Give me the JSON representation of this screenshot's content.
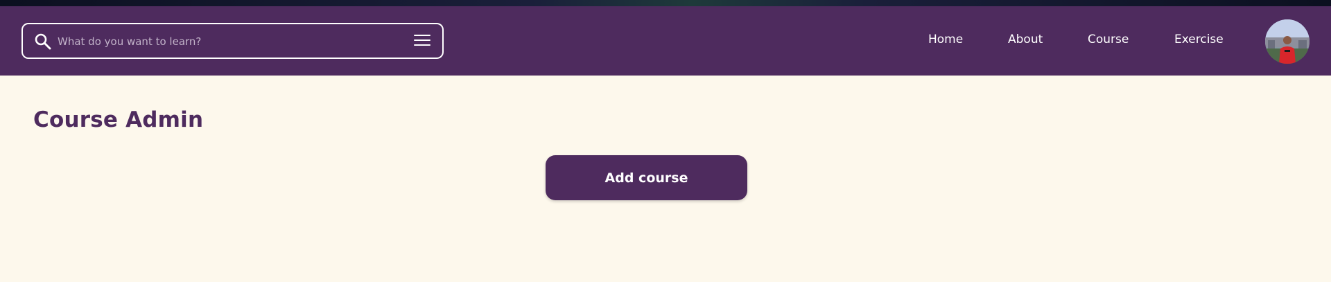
{
  "colors": {
    "brand": "#4e2b5e",
    "background": "#fdf8ec",
    "navText": "#ffffff"
  },
  "search": {
    "placeholder": "What do you want to learn?",
    "icon": "search-icon",
    "menu_icon": "menu-icon"
  },
  "nav": {
    "items": [
      {
        "label": "Home"
      },
      {
        "label": "About"
      },
      {
        "label": "Course"
      },
      {
        "label": "Exercise"
      }
    ],
    "avatar_icon": "user-avatar"
  },
  "main": {
    "title": "Course Admin",
    "add_button_label": "Add course"
  }
}
